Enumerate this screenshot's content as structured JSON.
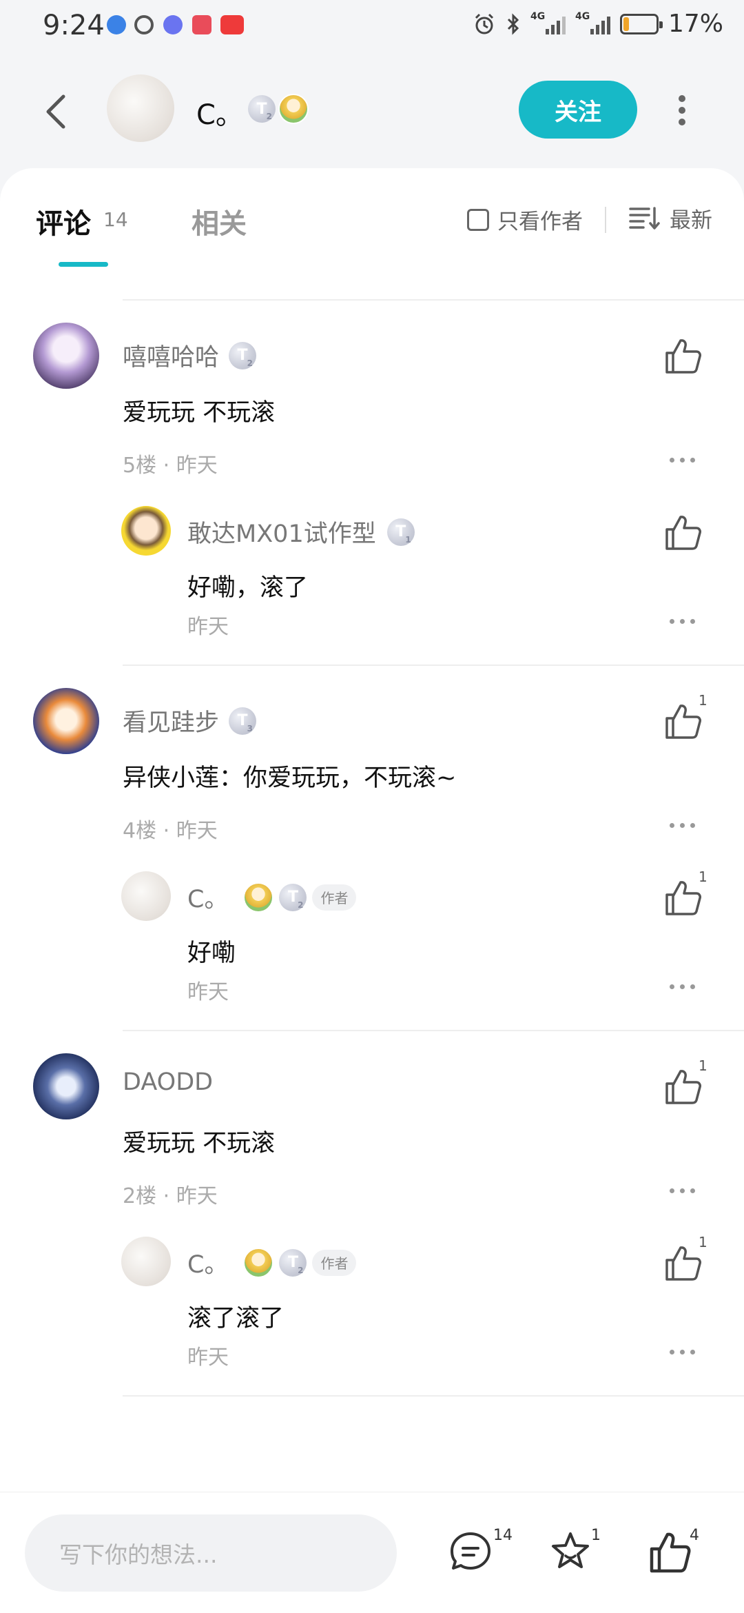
{
  "status": {
    "time": "9:24",
    "net1": "4G",
    "net2": "4G",
    "battery": "17%",
    "battery_level": 0.17
  },
  "header": {
    "username": "C。",
    "follow_label": "关注"
  },
  "tabs": {
    "comments_label": "评论",
    "comments_count": "14",
    "related_label": "相关"
  },
  "filters": {
    "only_author": "只看作者",
    "sort_label": "最新"
  },
  "colors": {
    "accent": "#17b9c7"
  },
  "comments": [
    {
      "name": "嘻嘻哈哈",
      "level": "2",
      "text": "爱玩玩 不玩滚",
      "meta": "5楼 · 昨天",
      "likes": "",
      "reply": {
        "name": "敢达MX01试作型",
        "level": "1",
        "text": "好嘞，滚了",
        "meta": "昨天",
        "likes": "",
        "author_tag": ""
      }
    },
    {
      "name": "看见跬步",
      "level": "3",
      "text": "异侠小莲：你爱玩玩，不玩滚~",
      "meta": "4楼 · 昨天",
      "likes": "1",
      "reply": {
        "name": "C。",
        "level": "2",
        "text": "好嘞",
        "meta": "昨天",
        "likes": "1",
        "author_tag": "作者"
      }
    },
    {
      "name": "DAODD",
      "level": "",
      "text": "爱玩玩 不玩滚",
      "meta": "2楼 · 昨天",
      "likes": "1",
      "reply": {
        "name": "C。",
        "level": "2",
        "text": "滚了滚了",
        "meta": "昨天",
        "likes": "1",
        "author_tag": "作者"
      }
    }
  ],
  "bottom": {
    "placeholder": "写下你的想法...",
    "comment_count": "14",
    "fav_count": "1",
    "like_count": "4"
  }
}
